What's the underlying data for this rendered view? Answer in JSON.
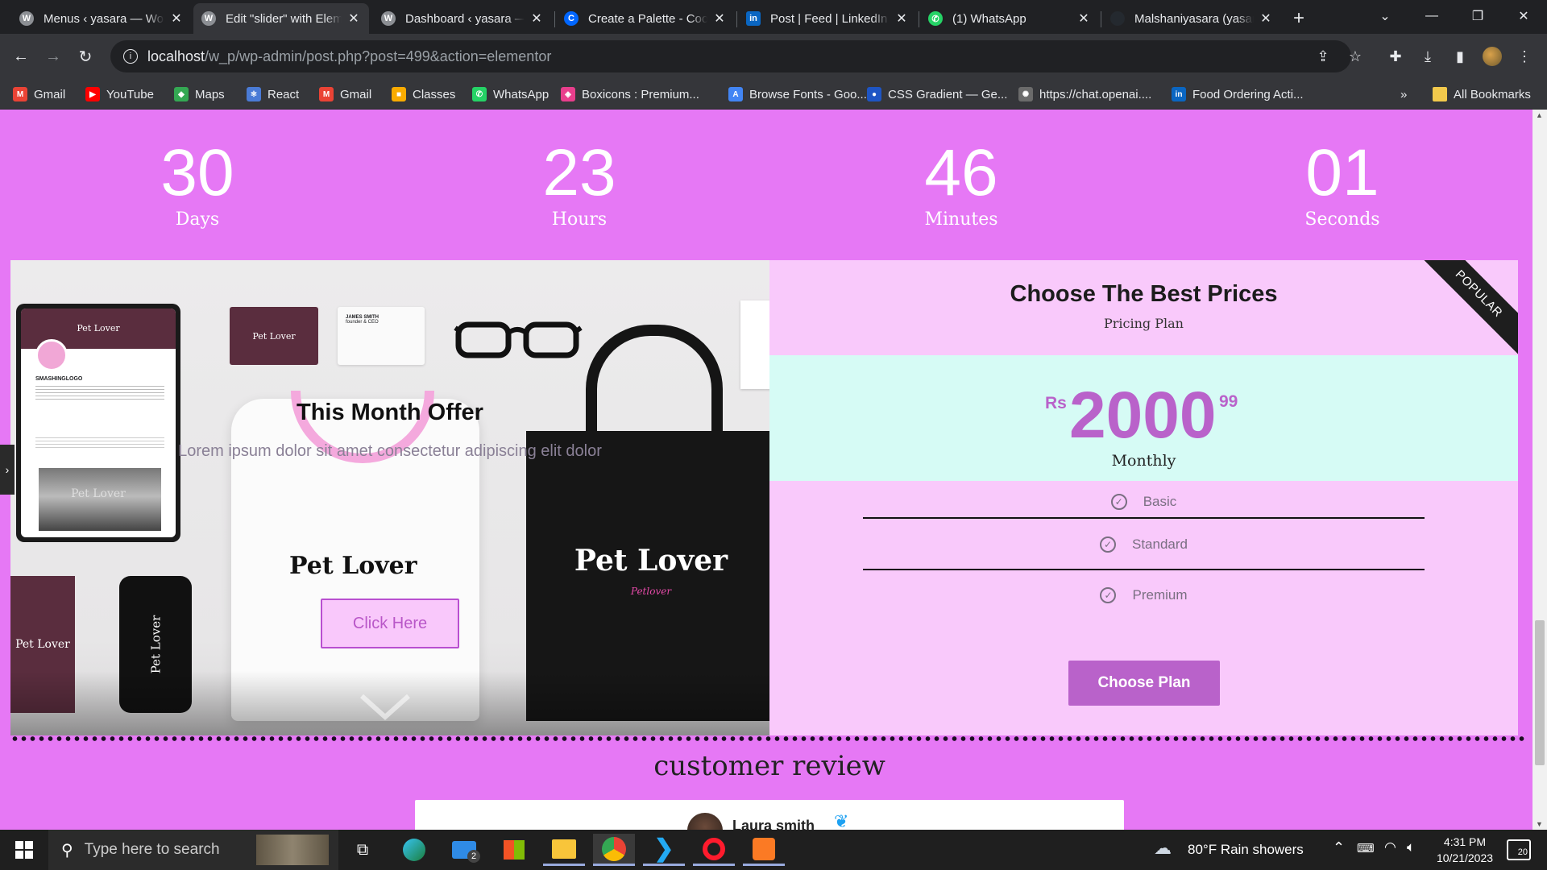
{
  "browser": {
    "tabs": [
      {
        "title": "Menus ‹ yasara — WordPress",
        "favicon": "wordpress",
        "color": "#8c8f94"
      },
      {
        "title": "Edit \"slider\" with Elementor",
        "favicon": "wordpress",
        "color": "#8c8f94"
      },
      {
        "title": "Dashboard ‹ yasara — WordPress",
        "favicon": "wordpress",
        "color": "#8c8f94"
      },
      {
        "title": "Create a Palette - Coolors",
        "favicon": "coolors",
        "color": "#0066ff"
      },
      {
        "title": "Post | Feed | LinkedIn",
        "favicon": "linkedin",
        "color": "#0a66c2"
      },
      {
        "title": "(1) WhatsApp",
        "favicon": "whatsapp",
        "color": "#25d366"
      },
      {
        "title": "Malshaniyasara (yasara)",
        "favicon": "github",
        "color": "#24292f"
      }
    ],
    "close_glyph": "✕",
    "new_tab_glyph": "+",
    "url_host": "localhost",
    "url_path": "/w_p/wp-admin/post.php?post=499&action=elementor",
    "bookmarks": [
      {
        "label": "Gmail",
        "icon": "gmail-icon",
        "color": "#ea4335",
        "glyph": "M"
      },
      {
        "label": "YouTube",
        "icon": "youtube-icon",
        "color": "#ff0000",
        "glyph": "▶"
      },
      {
        "label": "Maps",
        "icon": "maps-icon",
        "color": "#34a853",
        "glyph": "◆"
      },
      {
        "label": "React",
        "icon": "react-icon",
        "color": "#4a7bd6",
        "glyph": "⚛"
      },
      {
        "label": "Gmail",
        "icon": "gmail-icon",
        "color": "#ea4335",
        "glyph": "M"
      },
      {
        "label": "Classes",
        "icon": "classroom-icon",
        "color": "#f9ab00",
        "glyph": "■"
      },
      {
        "label": "WhatsApp",
        "icon": "whatsapp-icon",
        "color": "#25d366",
        "glyph": "✆"
      },
      {
        "label": "Boxicons : Premium...",
        "icon": "boxicons-icon",
        "color": "#e83e8c",
        "glyph": "◈"
      },
      {
        "label": "Browse Fonts - Goo...",
        "icon": "google-fonts-icon",
        "color": "#4285f4",
        "glyph": "A"
      },
      {
        "label": "CSS Gradient — Ge...",
        "icon": "css-gradient-icon",
        "color": "#1e55c4",
        "glyph": "●"
      },
      {
        "label": "https://chat.openai....",
        "icon": "openai-icon",
        "color": "#6b6b6b",
        "glyph": "✺"
      },
      {
        "label": "Food Ordering Acti...",
        "icon": "linkedin-icon",
        "color": "#0a66c2",
        "glyph": "in"
      }
    ],
    "bookmarks_overflow": "»",
    "all_bookmarks_label": "All Bookmarks"
  },
  "page": {
    "countdown": [
      {
        "value": "30",
        "label": "Days"
      },
      {
        "value": "23",
        "label": "Hours"
      },
      {
        "value": "46",
        "label": "Minutes"
      },
      {
        "value": "01",
        "label": "Seconds"
      }
    ],
    "slider": {
      "title": "This Month Offer",
      "text": "Lorem ipsum dolor sit amet consectetur adipiscing elit dolor",
      "button": "Click Here",
      "brand": "Pet Lover",
      "brand_sub": "Petlover",
      "card_name": "JAMES SMITH",
      "card_role": "founder & CEO",
      "profile_name": "SMASHINGLOGO"
    },
    "pricing": {
      "title": "Choose The Best Prices",
      "subtitle": "Pricing Plan",
      "ribbon": "POPULAR",
      "currency": "Rs",
      "amount": "2000",
      "cents": "99",
      "period": "Monthly",
      "features": [
        "Basic",
        "Standard",
        "Premium"
      ],
      "button": "Choose Plan",
      "accent": "#b962ca"
    },
    "review": {
      "title": "customer review",
      "reviewer": "Laura smith"
    },
    "background": "#e678f5"
  },
  "taskbar": {
    "search_placeholder": "Type here to search",
    "weather": "80°F  Rain showers",
    "time": "4:31 PM",
    "date": "10/21/2023",
    "notification_count": "20",
    "mail_badge": "2"
  }
}
